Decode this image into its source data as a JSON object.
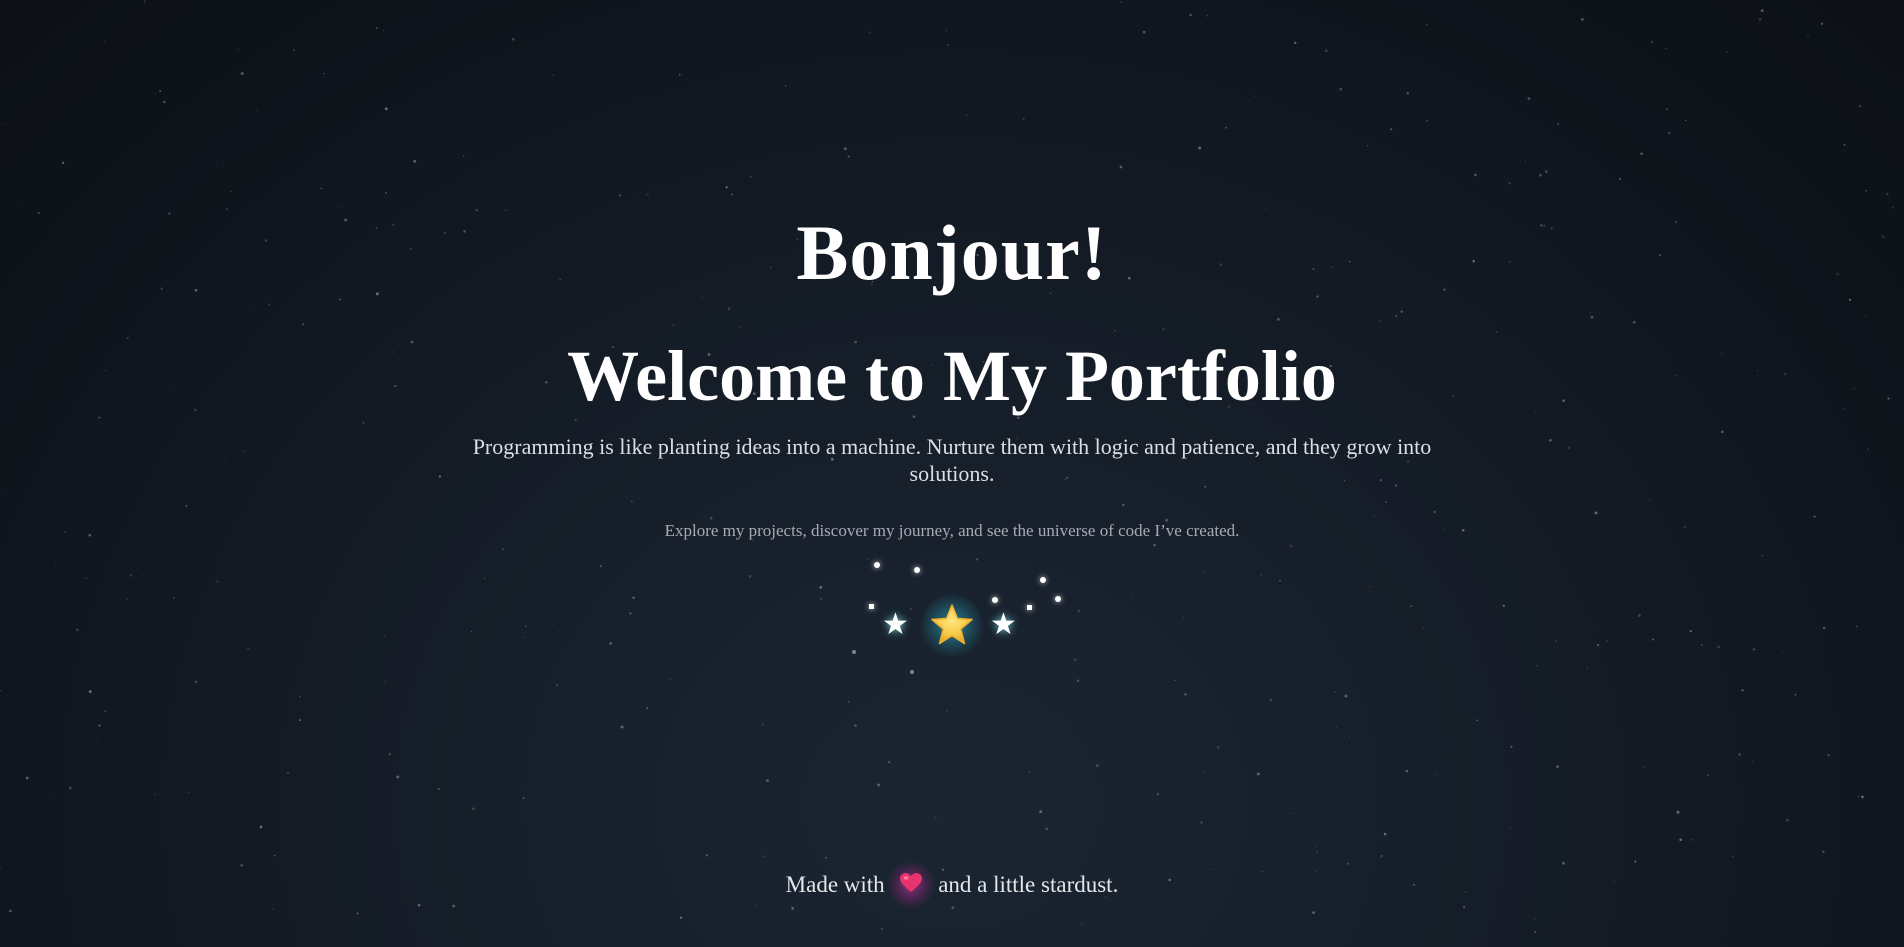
{
  "hero": {
    "greeting": "Bonjour!",
    "headline": "Welcome to My Portfolio",
    "tagline": "Programming is like planting ideas into a machine. Nurture them with logic and patience, and they grow into solutions.",
    "subline": "Explore my projects, discover my journey, and see the universe of code I’ve created."
  },
  "emblem": {
    "main_icon": "glowing-star-icon",
    "side_icon": "white-star-icon",
    "side_glyph": "★"
  },
  "footer": {
    "before": "Made with",
    "icon": "heart-icon",
    "after": "and a little stardust."
  },
  "colors": {
    "background": "#10151d",
    "text": "#ffffff",
    "muted_text": "#a6acb6",
    "star_glow": "#40d2dc",
    "star_fill": "#f5c542",
    "heart": "#e8336e",
    "heart_glow": "#e63cb4"
  }
}
